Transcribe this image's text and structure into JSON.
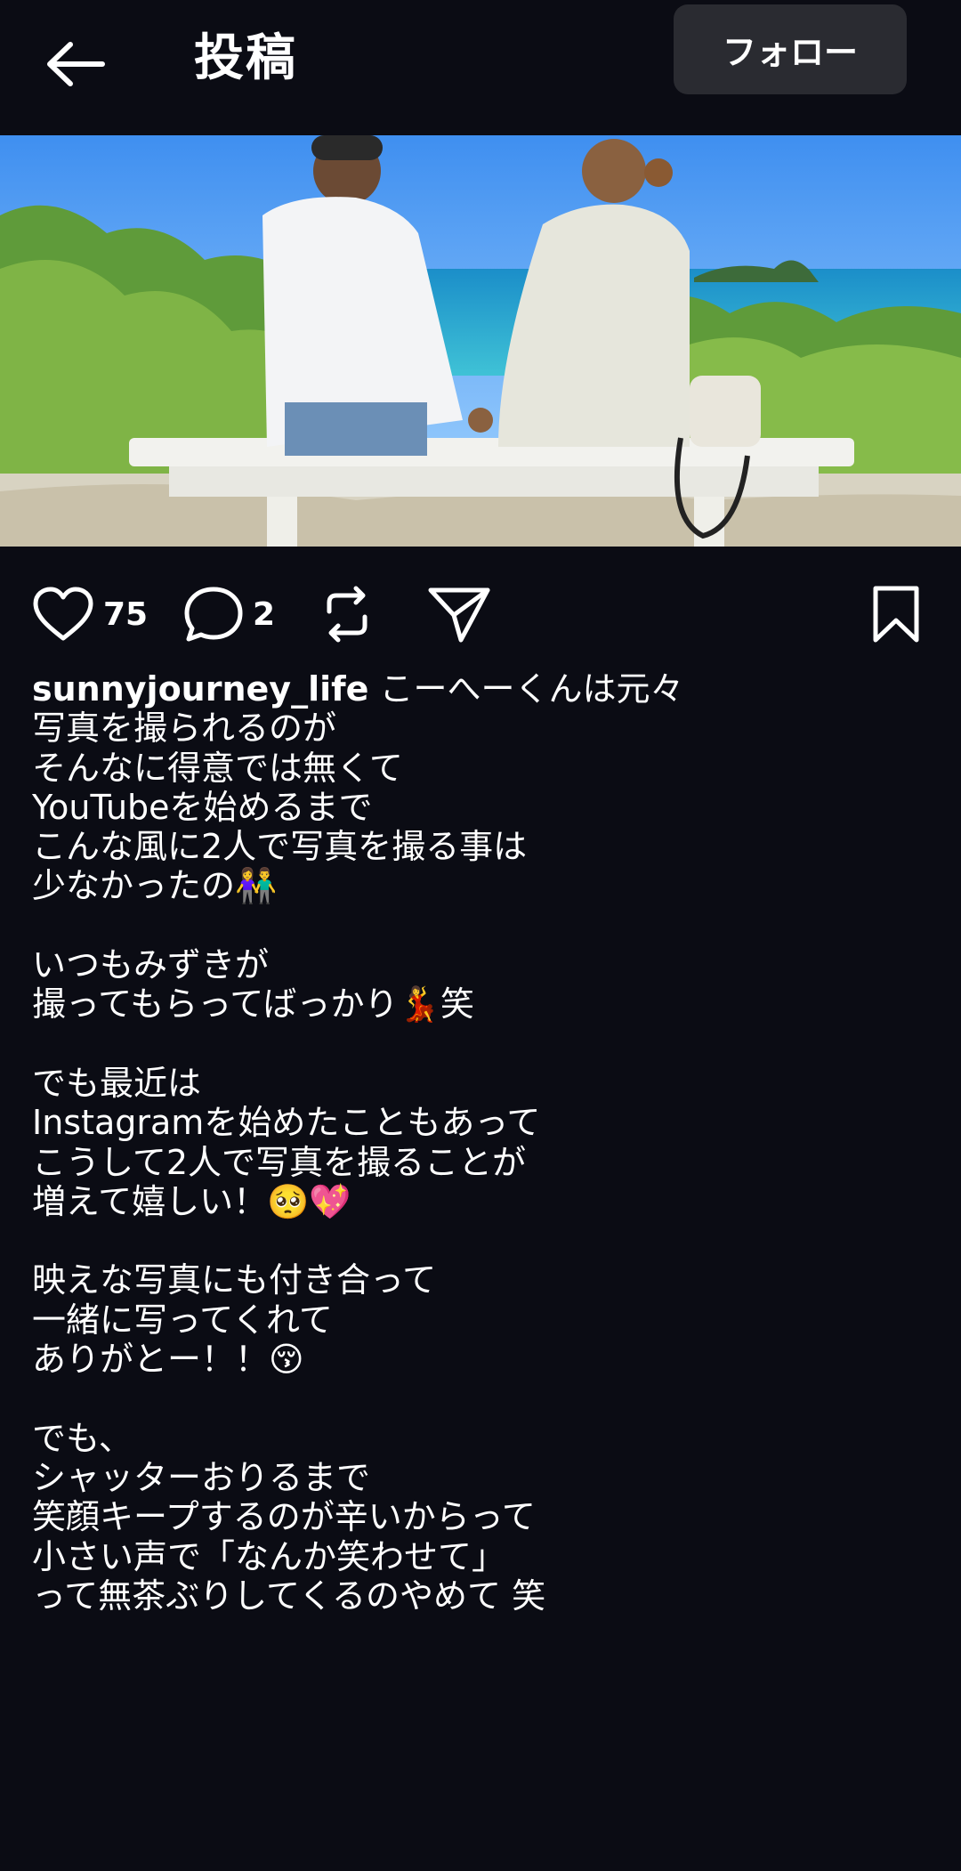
{
  "header": {
    "title": "投稿",
    "follow_label": "フォロー",
    "back_icon": "arrow-left-icon"
  },
  "photo": {
    "description_icon": "photo-couple-on-bench"
  },
  "actions": {
    "likes": "75",
    "comments": "2",
    "icons": [
      "heart-icon",
      "comment-icon",
      "repost-icon",
      "share-icon",
      "bookmark-icon"
    ]
  },
  "caption": {
    "username": "sunnyjourney_life",
    "first_line": " こーへーくんは元々",
    "lines": [
      "写真を撮られるのが",
      "そんなに得意では無くて",
      "YouTubeを始めるまで",
      "こんな風に2人で写真を撮る事は",
      "少なかったの👫",
      "",
      "いつもみずきが",
      "撮ってもらってばっかり💃笑",
      "",
      "でも最近は",
      "Instagramを始めたこともあって",
      "こうして2人で写真を撮ることが",
      "増えて嬉しい！🥺💖",
      "",
      "映えな写真にも付き合って",
      "一緒に写ってくれて",
      "ありがとー！！😚",
      "",
      "でも、",
      "シャッターおりるまで",
      "笑顔キープするのが辛いからって",
      "小さい声で「なんか笑わせて」",
      "って無茶ぶりしてくるのやめて 笑"
    ]
  },
  "colors": {
    "background": "#0b0c14",
    "button_bg": "#2a2b31",
    "text": "#ffffff"
  }
}
